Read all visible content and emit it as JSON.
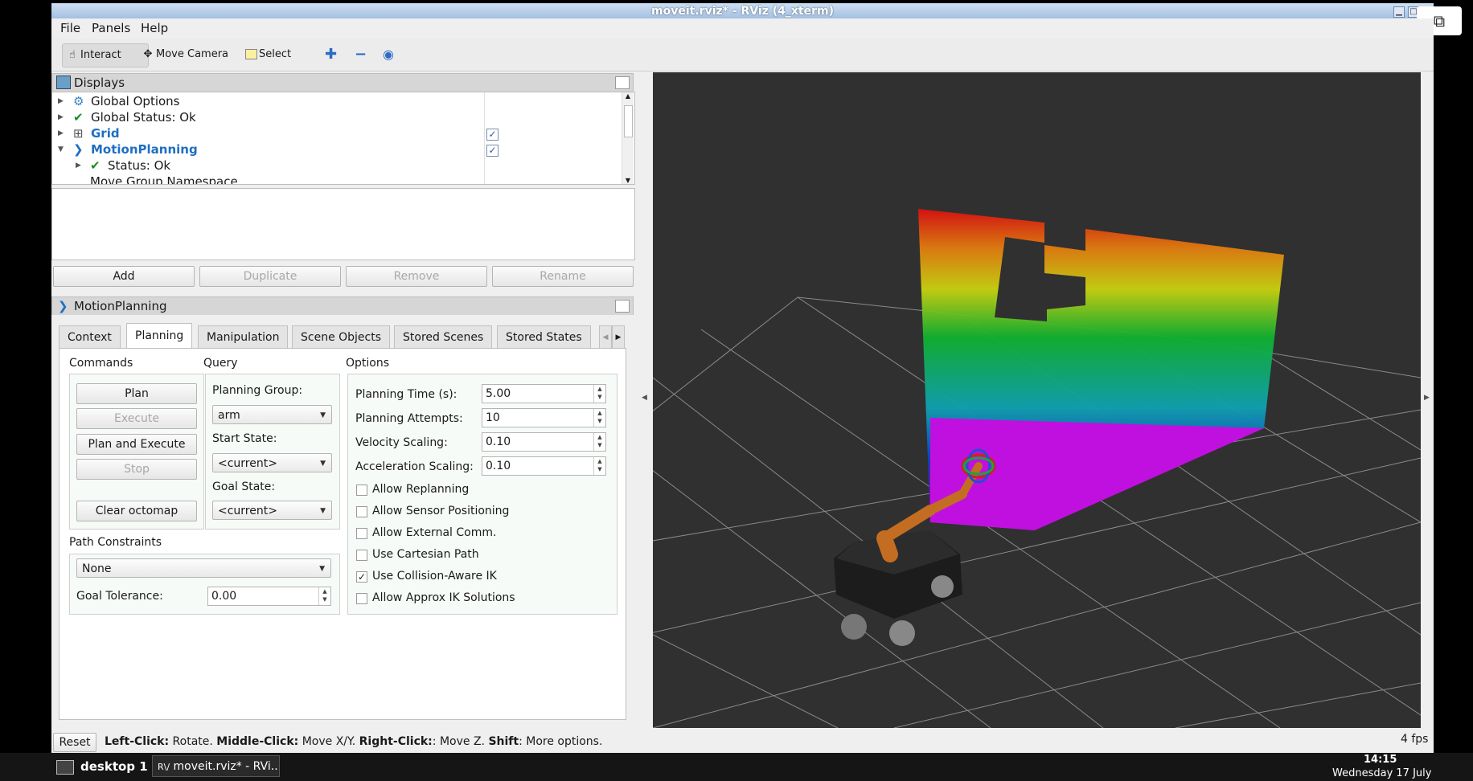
{
  "window": {
    "title": "moveit.rviz* - RViz (4_xterm)"
  },
  "menubar": {
    "file": "File",
    "panels": "Panels",
    "help": "Help"
  },
  "toolbar": {
    "interact": "Interact",
    "move_camera": "Move Camera",
    "select": "Select"
  },
  "displays": {
    "title": "Displays",
    "items": [
      {
        "label": "Global Options"
      },
      {
        "label": "Global Status: Ok"
      },
      {
        "label": "Grid",
        "checked": true
      },
      {
        "label": "MotionPlanning",
        "checked": true
      },
      {
        "label": "Status: Ok"
      },
      {
        "label": "Move Group Namespace"
      }
    ],
    "buttons": {
      "add": "Add",
      "duplicate": "Duplicate",
      "remove": "Remove",
      "rename": "Rename"
    }
  },
  "motion_panel": {
    "title": "MotionPlanning",
    "tabs": [
      "Context",
      "Planning",
      "Manipulation",
      "Scene Objects",
      "Stored Scenes",
      "Stored States"
    ],
    "active_tab": "Planning",
    "commands": {
      "title": "Commands",
      "plan": "Plan",
      "execute": "Execute",
      "plan_execute": "Plan and Execute",
      "stop": "Stop",
      "clear_octomap": "Clear octomap"
    },
    "query": {
      "title": "Query",
      "planning_group_label": "Planning Group:",
      "planning_group": "arm",
      "start_state_label": "Start State:",
      "start_state": "<current>",
      "goal_state_label": "Goal State:",
      "goal_state": "<current>"
    },
    "options": {
      "title": "Options",
      "planning_time_label": "Planning Time (s):",
      "planning_time": "5.00",
      "planning_attempts_label": "Planning Attempts:",
      "planning_attempts": "10",
      "velocity_label": "Velocity Scaling:",
      "velocity": "0.10",
      "acceleration_label": "Acceleration Scaling:",
      "acceleration": "0.10",
      "checkboxes": [
        {
          "label": "Allow Replanning",
          "checked": false
        },
        {
          "label": "Allow Sensor Positioning",
          "checked": false
        },
        {
          "label": "Allow External Comm.",
          "checked": false
        },
        {
          "label": "Use Cartesian Path",
          "checked": false
        },
        {
          "label": "Use Collision-Aware IK",
          "checked": true
        },
        {
          "label": "Allow Approx IK Solutions",
          "checked": false
        }
      ]
    },
    "path_constraints": {
      "title": "Path Constraints",
      "value": "None",
      "goal_tolerance_label": "Goal Tolerance:",
      "goal_tolerance": "0.00"
    }
  },
  "statusbar": {
    "reset": "Reset",
    "left_click": "Left-Click:",
    "left_click_desc": " Rotate. ",
    "middle_click": "Middle-Click:",
    "middle_click_desc": " Move X/Y. ",
    "right_click": "Right-Click:",
    "right_click_desc": ": Move Z. ",
    "shift": "Shift",
    "shift_desc": ": More options.",
    "fps": "4 fps"
  },
  "taskbar": {
    "desktop": "desktop 1",
    "task": "moveit.rviz* - RVi...",
    "time": "14:15",
    "date": "Wednesday 17 July"
  }
}
